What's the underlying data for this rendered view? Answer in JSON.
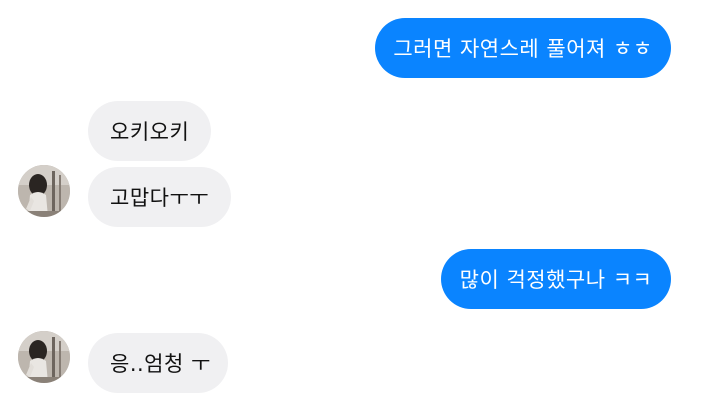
{
  "messages": [
    {
      "from": "me",
      "text": "그러면 자연스레 풀어져 ㅎㅎ"
    },
    {
      "from": "other",
      "text": "오키오키"
    },
    {
      "from": "other",
      "text": "고맙다ㅜㅜ"
    },
    {
      "from": "me",
      "text": "많이 걱정했구나 ㅋㅋ"
    },
    {
      "from": "other",
      "text": "응..엄청 ㅜ"
    }
  ],
  "colors": {
    "outgoing_bubble": "#0a84ff",
    "incoming_bubble": "#f0f0f2"
  },
  "icons": {
    "avatar": "contact-avatar-photo"
  }
}
